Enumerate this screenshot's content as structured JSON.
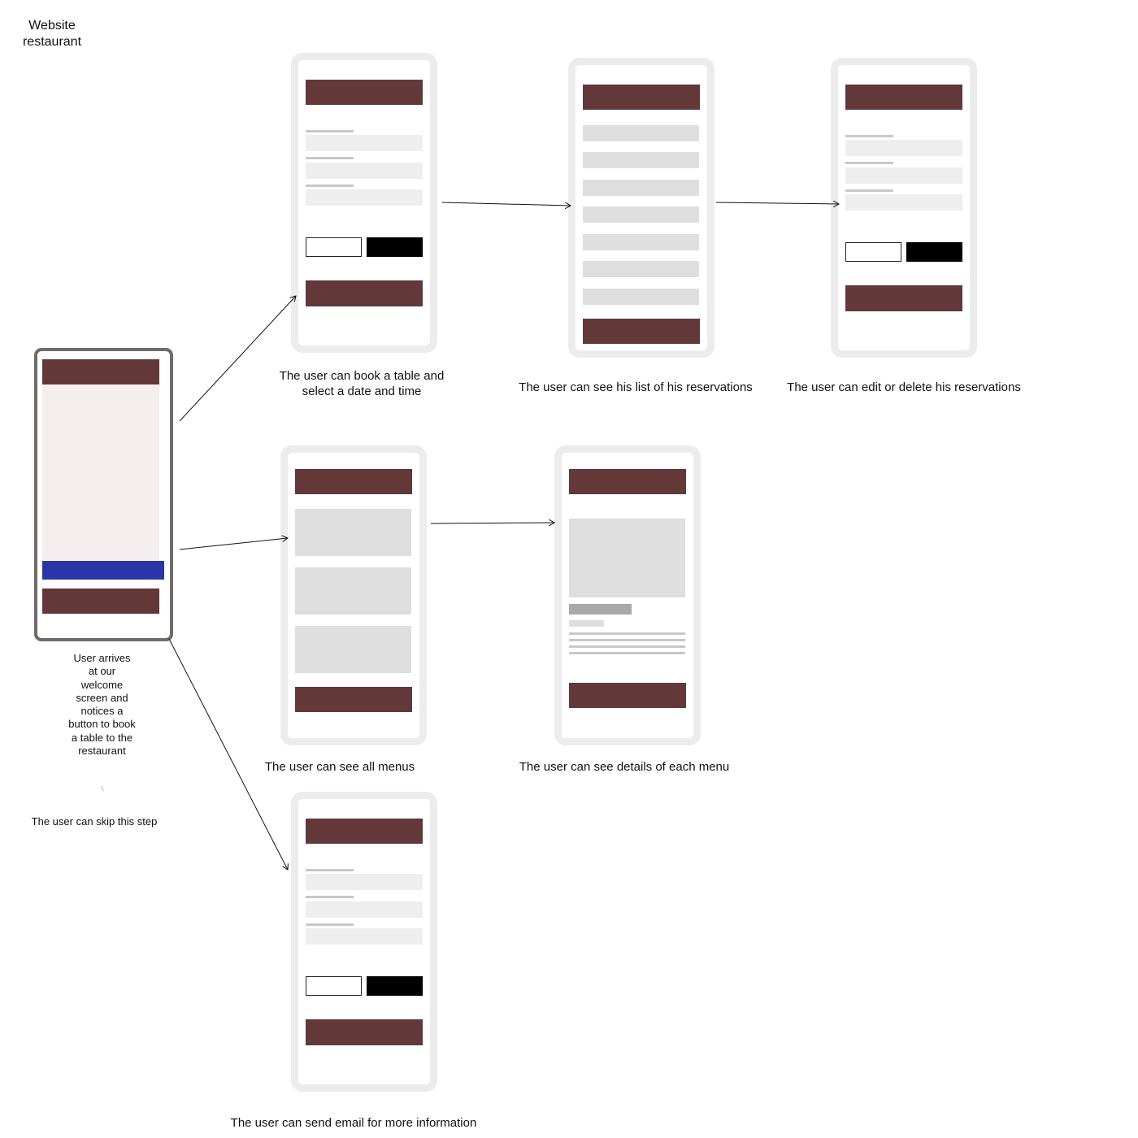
{
  "title": "Website restaurant",
  "welcome": {
    "description": "User arrives at our welcome screen and notices a button to book a table to the restaurant",
    "icon": "fork-knife-icon",
    "skip_note": "The user can skip this step"
  },
  "captions": {
    "book": "The user can book a table and select a date and time",
    "reservations_list": "The user can see his list of his reservations",
    "edit_reservations": "The user can edit or delete his reservations",
    "menus": "The user can see all menus",
    "menu_details": "The user can see details of each menu",
    "email": "The user can send email for more information"
  },
  "colors": {
    "header_bar": "#623838",
    "cta_button": "#2b35a5",
    "frame_border": "#ececec",
    "welcome_border": "#716a68"
  }
}
